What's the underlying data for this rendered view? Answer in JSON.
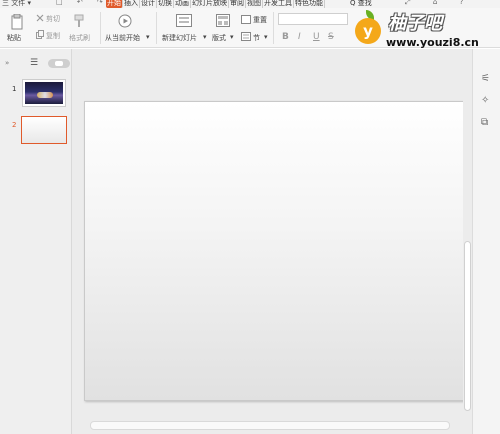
{
  "menu": {
    "file": "三 文件 ▾"
  },
  "quick_access": "□ ↶ ↷",
  "tabs": [
    {
      "label": "开始",
      "active": true
    },
    {
      "label": "插入"
    },
    {
      "label": "设计"
    },
    {
      "label": "切换"
    },
    {
      "label": "动画"
    },
    {
      "label": "幻灯片放映"
    },
    {
      "label": "审阅"
    },
    {
      "label": "视图"
    },
    {
      "label": "开发工具"
    },
    {
      "label": "特色功能"
    }
  ],
  "search_tab": "Q 查找",
  "ribbon": {
    "paste": "粘贴",
    "cut": "剪切",
    "copy": "复制",
    "format_painter": "格式刷",
    "play_from_current": "从当前开始",
    "new_slide": "新建幻灯片",
    "layout": "版式",
    "reset": "重置",
    "section": "节"
  },
  "format_buttons": [
    "B",
    "I",
    "U",
    "S"
  ],
  "watermark": {
    "logo_letter": "y",
    "brand": "柚子吧",
    "url": "www.youzi8.cn"
  },
  "slides": [
    {
      "number": "1"
    },
    {
      "number": "2"
    }
  ],
  "icons": [
    "paste-icon",
    "cut-icon",
    "copy-icon",
    "format-painter-icon",
    "play-icon",
    "new-slide-icon",
    "layout-icon",
    "reset-icon",
    "section-icon",
    "list-view-icon",
    "properties-icon",
    "animation-icon",
    "slide-pane-icon"
  ],
  "colors": {
    "accent": "#e05a2b",
    "watermark_orange": "#f4a81a",
    "watermark_green": "#6ab023"
  }
}
